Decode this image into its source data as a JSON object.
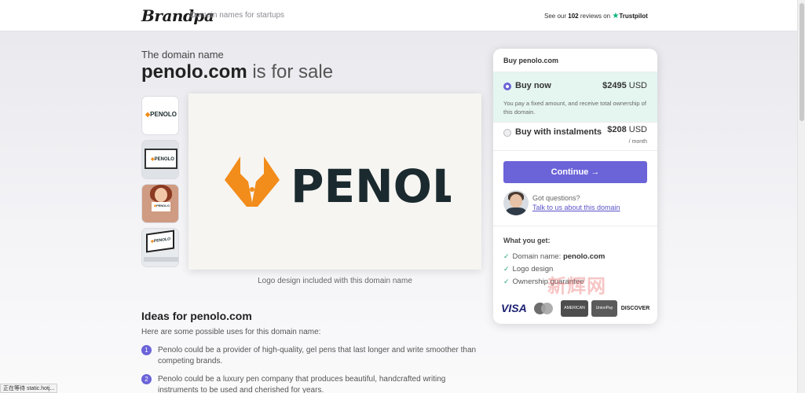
{
  "header": {
    "logo": "Brandpa",
    "tagline": "Domain names for startups",
    "reviews_prefix": "See our",
    "reviews_count": "102",
    "reviews_suffix": "reviews on",
    "trustpilot": "Trustpilot"
  },
  "hero": {
    "kicker": "The domain name",
    "domain": "penolo.com",
    "for_sale": "is for sale"
  },
  "thumbnails": [
    {
      "label": "PENOLO"
    },
    {
      "label": "PENOLO"
    },
    {
      "label": "PENOLO"
    },
    {
      "label": "PENOLO"
    }
  ],
  "preview": {
    "logo_text": "PENOLO",
    "caption": "Logo design included with this domain name"
  },
  "ideas": {
    "title": "Ideas for penolo.com",
    "subtitle": "Here are some possible uses for this domain name:",
    "items": [
      {
        "num": "1",
        "text": "Penolo could be a provider of high-quality, gel pens that last longer and write smoother than competing brands."
      },
      {
        "num": "2",
        "text": "Penolo could be a luxury pen company that produces beautiful, handcrafted writing instruments to be used and cherished for years."
      }
    ]
  },
  "purchase": {
    "heading": "Buy penolo.com",
    "buy_now": {
      "label": "Buy now",
      "price": "$2495",
      "currency": "USD",
      "description": "You pay a fixed amount, and receive total ownership of this domain."
    },
    "instalments": {
      "label": "Buy with instalments",
      "price": "$208",
      "currency": "USD",
      "period": "/ month"
    },
    "continue_label": "Continue →",
    "questions": "Got questions?",
    "talk_link": "Talk to us about this domain",
    "what_you_get": "What you get:",
    "features": [
      {
        "label": "Domain name:",
        "value": "penolo.com"
      },
      {
        "label": "Logo design",
        "value": ""
      },
      {
        "label": "Ownership guarantee",
        "value": ""
      }
    ],
    "payment_methods": [
      "VISA",
      "Mastercard",
      "AMERICAN EXPRESS",
      "UnionPay",
      "DISCOVER"
    ]
  },
  "watermark": "新辉网",
  "status_bar": "正在等待 static.hotj...",
  "colors": {
    "accent": "#6b63d8",
    "brand_orange": "#f28c1a",
    "brand_dark": "#1b2a2e",
    "selected_bg": "#e5f6f1",
    "trustpilot_green": "#00b67a"
  }
}
